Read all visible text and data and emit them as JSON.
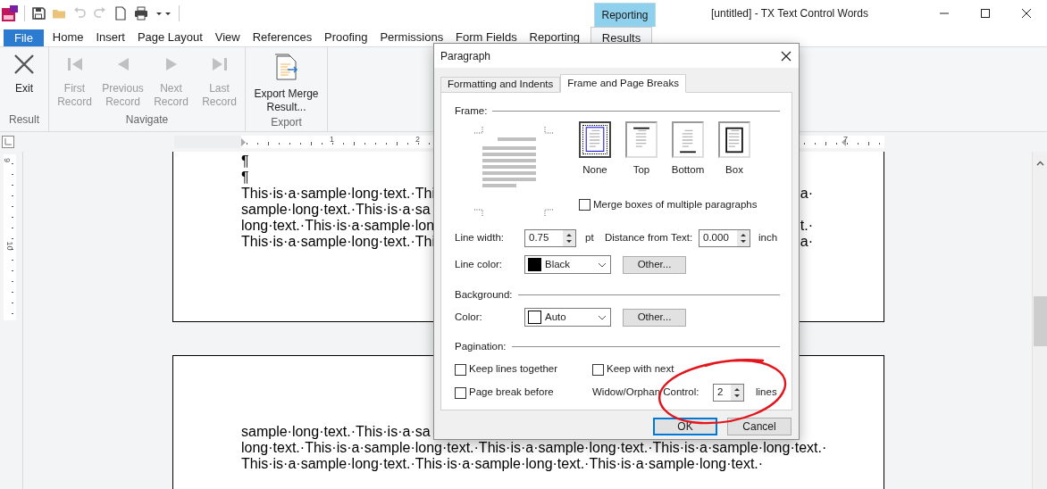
{
  "window": {
    "title": "[untitled] - TX Text Control Words",
    "context_group": "Reporting"
  },
  "quick_access": [
    {
      "kind": "save",
      "disabled": false
    },
    {
      "kind": "open",
      "disabled": false
    },
    {
      "kind": "undo",
      "disabled": true
    },
    {
      "kind": "redo",
      "disabled": true
    },
    {
      "kind": "new",
      "disabled": false
    },
    {
      "kind": "print",
      "disabled": false
    }
  ],
  "ribbon_tabs": [
    {
      "label": "File",
      "kind": "file",
      "selected": false
    },
    {
      "label": "Home",
      "kind": "tab",
      "selected": false
    },
    {
      "label": "Insert",
      "kind": "tab",
      "selected": false
    },
    {
      "label": "Page Layout",
      "kind": "tab",
      "selected": false
    },
    {
      "label": "View",
      "kind": "tab",
      "selected": false
    },
    {
      "label": "References",
      "kind": "tab",
      "selected": false
    },
    {
      "label": "Proofing",
      "kind": "tab",
      "selected": false
    },
    {
      "label": "Permissions",
      "kind": "tab",
      "selected": false
    },
    {
      "label": "Form Fields",
      "kind": "tab",
      "selected": false
    },
    {
      "label": "Reporting",
      "kind": "tab",
      "selected": false
    },
    {
      "label": "Results",
      "kind": "context",
      "selected": true
    }
  ],
  "ribbon_groups": [
    {
      "label": "Result",
      "buttons": [
        {
          "kind": "exit",
          "label": "Exit",
          "disabled": false
        }
      ]
    },
    {
      "label": "Navigate",
      "buttons": [
        {
          "kind": "first",
          "label": "First Record",
          "disabled": true
        },
        {
          "kind": "previous",
          "label": "Previous Record",
          "disabled": true
        },
        {
          "kind": "next",
          "label": "Next Record",
          "disabled": true
        },
        {
          "kind": "last",
          "label": "Last Record",
          "disabled": true
        }
      ]
    },
    {
      "label": "Export",
      "buttons": [
        {
          "kind": "export",
          "label": "Export Merge Result...",
          "disabled": false
        }
      ]
    }
  ],
  "ruler": {
    "horizontal": [
      "1",
      "2",
      "7"
    ],
    "vertical": [
      "9",
      "10"
    ]
  },
  "pages": [
    {
      "lines": [
        {
          "left": "¶"
        },
        {
          "left": "¶"
        },
        {
          "left": "This·is·a·sample·long·text.·Thi",
          "right": "a·"
        },
        {
          "left": "sample·long·text.·This·is·a·sa"
        },
        {
          "left": "long·text.·This·is·a·sample·lon",
          "right": "t.·"
        },
        {
          "left": "This·is·a·sample·long·text.·Thi",
          "right": "a·"
        }
      ]
    },
    {
      "lines": [
        {
          "left": "sample·long·text.·This·is·a·sa"
        },
        {
          "left": "long·text.·This·is·a·sample·long·text.·This·is·a·sample·long·text.·This·is·a·sample·long·text.·"
        },
        {
          "left": "This·is·a·sample·long·text.·This·is·a·sample·long·text.·This·is·a·sample·long·text.·"
        }
      ]
    }
  ],
  "dialog": {
    "title": "Paragraph",
    "tabs": [
      {
        "label": "Formatting and Indents",
        "selected": false
      },
      {
        "label": "Frame and Page Breaks",
        "selected": true
      }
    ],
    "frame": {
      "heading": "Frame:",
      "options": [
        {
          "kind": "none",
          "label": "None",
          "selected": true
        },
        {
          "kind": "top",
          "label": "Top",
          "selected": false
        },
        {
          "kind": "bottom",
          "label": "Bottom",
          "selected": false
        },
        {
          "kind": "box",
          "label": "Box",
          "selected": false
        }
      ],
      "merge_boxes": {
        "label": "Merge boxes of multiple paragraphs",
        "checked": false
      },
      "line_width": {
        "label": "Line width:",
        "value": "0.75",
        "unit": "pt"
      },
      "distance": {
        "label": "Distance from Text:",
        "value": "0.000",
        "unit": "inch"
      },
      "line_color": {
        "label": "Line color:",
        "value": "Black",
        "color": "#000000",
        "button": "Other..."
      }
    },
    "background": {
      "heading": "Background:",
      "color": {
        "label": "Color:",
        "value": "Auto",
        "color": "#ffffff",
        "button": "Other..."
      }
    },
    "pagination": {
      "heading": "Pagination:",
      "keep_lines_together": {
        "label": "Keep lines together",
        "checked": false
      },
      "keep_with_next": {
        "label": "Keep with next",
        "checked": false
      },
      "page_break_before": {
        "label": "Page break before",
        "checked": false
      },
      "widow_orphan": {
        "label": "Widow/Orphan Control:",
        "value": "2",
        "unit": "lines"
      }
    },
    "buttons": [
      {
        "label": "OK",
        "default": true
      },
      {
        "label": "Cancel",
        "default": false
      }
    ]
  }
}
